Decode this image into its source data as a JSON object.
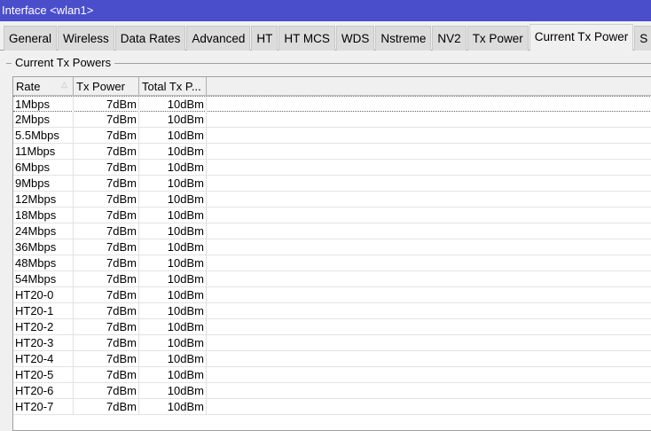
{
  "window": {
    "title": "Interface <wlan1>"
  },
  "tabs": [
    "General",
    "Wireless",
    "Data Rates",
    "Advanced",
    "HT",
    "HT MCS",
    "WDS",
    "Nstreme",
    "NV2",
    "Tx Power",
    "Current Tx Power",
    "S"
  ],
  "active_tab": "Current Tx Power",
  "group": {
    "label": "Current Tx Powers"
  },
  "table": {
    "columns": [
      "Rate",
      "Tx Power",
      "Total Tx P..."
    ],
    "sort_icon": "sort-ascending-icon",
    "rows": [
      [
        "1Mbps",
        "7dBm",
        "10dBm"
      ],
      [
        "2Mbps",
        "7dBm",
        "10dBm"
      ],
      [
        "5.5Mbps",
        "7dBm",
        "10dBm"
      ],
      [
        "11Mbps",
        "7dBm",
        "10dBm"
      ],
      [
        "6Mbps",
        "7dBm",
        "10dBm"
      ],
      [
        "9Mbps",
        "7dBm",
        "10dBm"
      ],
      [
        "12Mbps",
        "7dBm",
        "10dBm"
      ],
      [
        "18Mbps",
        "7dBm",
        "10dBm"
      ],
      [
        "24Mbps",
        "7dBm",
        "10dBm"
      ],
      [
        "36Mbps",
        "7dBm",
        "10dBm"
      ],
      [
        "48Mbps",
        "7dBm",
        "10dBm"
      ],
      [
        "54Mbps",
        "7dBm",
        "10dBm"
      ],
      [
        "HT20-0",
        "7dBm",
        "10dBm"
      ],
      [
        "HT20-1",
        "7dBm",
        "10dBm"
      ],
      [
        "HT20-2",
        "7dBm",
        "10dBm"
      ],
      [
        "HT20-3",
        "7dBm",
        "10dBm"
      ],
      [
        "HT20-4",
        "7dBm",
        "10dBm"
      ],
      [
        "HT20-5",
        "7dBm",
        "10dBm"
      ],
      [
        "HT20-6",
        "7dBm",
        "10dBm"
      ],
      [
        "HT20-7",
        "7dBm",
        "10dBm"
      ]
    ]
  }
}
